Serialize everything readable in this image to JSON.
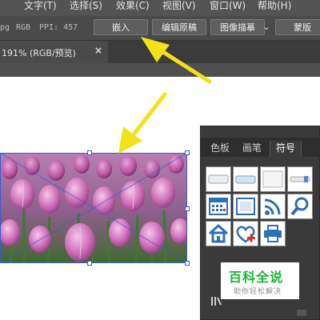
{
  "menubar": {
    "items": [
      {
        "label": "文字(T)"
      },
      {
        "label": "选择(S)"
      },
      {
        "label": "效果(C)"
      },
      {
        "label": "视图(V)"
      },
      {
        "label": "窗口(W)"
      },
      {
        "label": "帮助(H)"
      }
    ]
  },
  "options_bar": {
    "file_fragment": "pg",
    "color_mode": "RGB",
    "ppi": "PPI: 457",
    "embed_label": "嵌入",
    "edit_original_label": "编辑原稿",
    "image_trace_label": "图像描摹",
    "mask_label": "蒙版"
  },
  "document_tab": {
    "title": "191% (RGB/预览)",
    "close_symbol": "×"
  },
  "panel": {
    "tabs": [
      {
        "label": "色板"
      },
      {
        "label": "画笔"
      },
      {
        "label": "符号"
      }
    ],
    "active_tab": "符号",
    "symbols": [
      {
        "name": "button-plain-icon"
      },
      {
        "name": "button-bar-icon"
      },
      {
        "name": "button-blank-icon"
      },
      {
        "name": "slider-icon"
      },
      {
        "name": "calendar-icon"
      },
      {
        "name": "film-frame-icon"
      },
      {
        "name": "rss-feed-icon"
      },
      {
        "name": "magnifier-icon"
      },
      {
        "name": "home-icon"
      },
      {
        "name": "heart-plus-icon"
      },
      {
        "name": "printer-icon"
      }
    ]
  },
  "watermark": {
    "main": "百科全说",
    "sub": "助你轻松解决"
  },
  "colors": {
    "menubar": "#535353",
    "panel": "#3a3a3a",
    "arrow": "#f2e21a",
    "logo_green": "#19b436",
    "selection_blue": "#3a5bd0"
  }
}
